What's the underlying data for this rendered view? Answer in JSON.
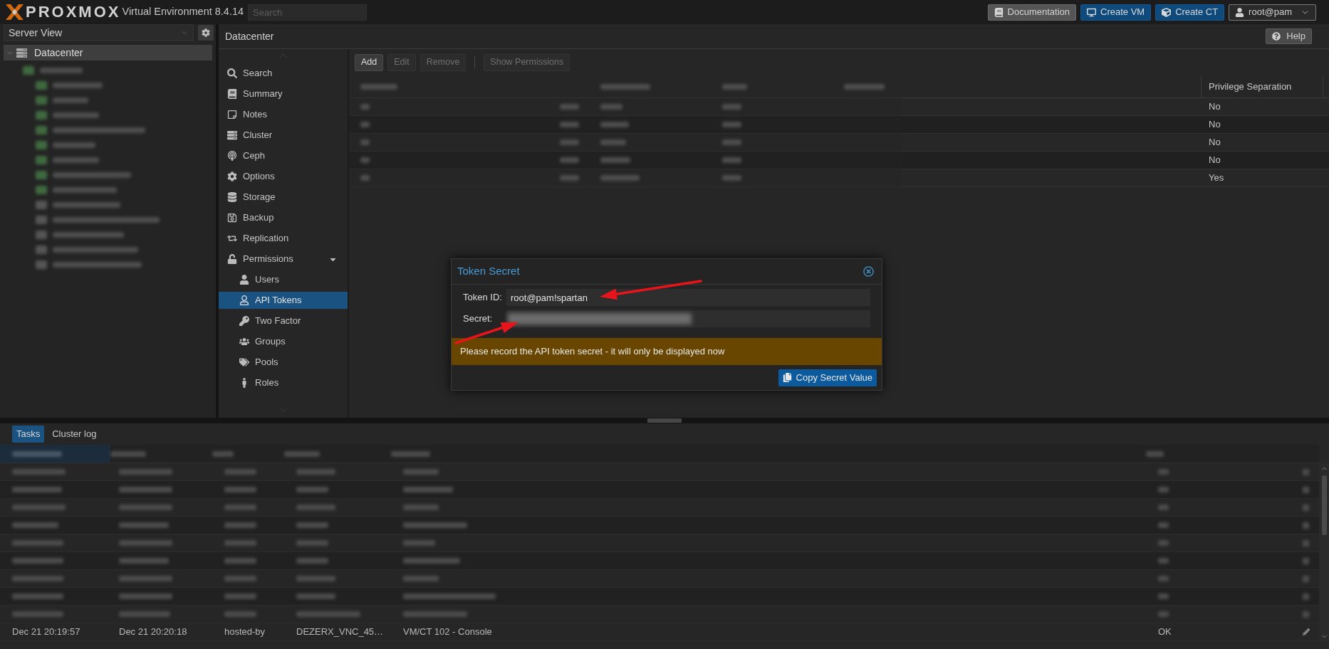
{
  "header": {
    "logo": "PROXMOX",
    "product": "Virtual Environment 8.4.14",
    "search": {
      "placeholder": "Search"
    },
    "buttons": [
      {
        "label": "Documentation",
        "kind": "plain"
      },
      {
        "label": "Create VM",
        "kind": "primary"
      },
      {
        "label": "Create CT",
        "kind": "primary"
      },
      {
        "label": "root@pam",
        "kind": "menu"
      }
    ]
  },
  "sidebar": {
    "view": "Server View",
    "tree": [
      {
        "label": "Datacenter",
        "selected": true,
        "expanded": true
      }
    ]
  },
  "panel": {
    "title": "Datacenter",
    "help": "Help"
  },
  "nav": {
    "items": [
      {
        "label": "Search",
        "selected": false
      },
      {
        "label": "Summary",
        "selected": false
      },
      {
        "label": "Notes",
        "selected": false
      },
      {
        "label": "Cluster",
        "selected": false
      },
      {
        "label": "Ceph",
        "selected": false
      },
      {
        "label": "Options",
        "selected": false
      },
      {
        "label": "Storage",
        "selected": false
      },
      {
        "label": "Backup",
        "selected": false
      },
      {
        "label": "Replication",
        "selected": false
      },
      {
        "label": "Permissions",
        "selected": false,
        "expanded": true,
        "children": [
          {
            "label": "Users",
            "selected": false
          },
          {
            "label": "API Tokens",
            "selected": true
          },
          {
            "label": "Two Factor",
            "selected": false
          },
          {
            "label": "Groups",
            "selected": false
          },
          {
            "label": "Pools",
            "selected": false
          },
          {
            "label": "Roles",
            "selected": false
          }
        ]
      }
    ]
  },
  "toolbar": {
    "buttons": [
      {
        "kind": "button",
        "label": "Add",
        "disabled": false
      },
      {
        "kind": "button",
        "label": "Edit",
        "disabled": true
      },
      {
        "kind": "button",
        "label": "Remove",
        "disabled": true
      },
      {
        "kind": "separator"
      },
      {
        "kind": "button",
        "label": "Show Permissions",
        "disabled": true
      }
    ]
  },
  "table": {
    "columns": [
      "Privilege Separation"
    ],
    "rows": [
      {
        "privilege_separation": "No"
      },
      {
        "privilege_separation": "No"
      },
      {
        "privilege_separation": "No"
      },
      {
        "privilege_separation": "No"
      },
      {
        "privilege_separation": "Yes"
      }
    ]
  },
  "dialog": {
    "title": "Token Secret",
    "fields": [
      {
        "kind": "text",
        "label": "Token ID:",
        "value": "root@pam!spartan"
      },
      {
        "kind": "redacted",
        "label": "Secret:"
      }
    ],
    "warning": "Please record the API token secret - it will only be displayed now",
    "button": "Copy Secret Value"
  },
  "bottom_panel": {
    "tabs": [
      {
        "label": "Tasks",
        "selected": true
      },
      {
        "label": "Cluster log",
        "selected": false
      }
    ],
    "rows": [
      {
        "column_1": "Dec 21 20:19:57",
        "column_2": "Dec 21 20:20:18",
        "column_3": "hosted-by",
        "column_4": "DEZERX_VNC_45…",
        "column_5": "VM/CT 102 - Console",
        "column_6": "OK"
      }
    ]
  }
}
